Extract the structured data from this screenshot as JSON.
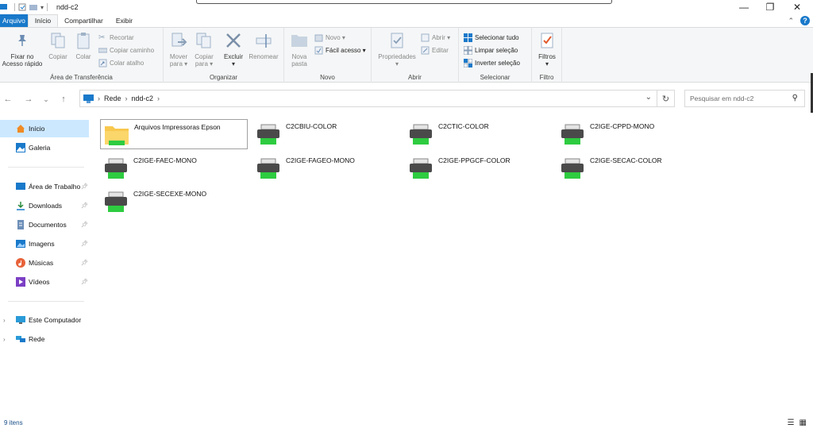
{
  "window": {
    "title": "ndd-c2",
    "minimize": "—",
    "maximize": "❐",
    "close": "✕"
  },
  "tabs": [
    {
      "label": "Arquivo"
    },
    {
      "label": "Início"
    },
    {
      "label": "Compartilhar"
    },
    {
      "label": "Exibir"
    }
  ],
  "ribbon": {
    "clipboard": {
      "label": "Área de Transferência",
      "pin_line1": "Fixar no",
      "pin_line2": "Acesso rápido",
      "copy": "Copiar",
      "paste": "Colar",
      "cut": "Recortar",
      "copy_path": "Copiar caminho",
      "paste_shortcut": "Colar atalho"
    },
    "organize": {
      "label": "Organizar",
      "move_line1": "Mover",
      "move_line2": "para ▾",
      "copy_line1": "Copiar",
      "copy_line2": "para ▾",
      "delete_line1": "Excluir",
      "delete_line2": "▾",
      "rename": "Renomear"
    },
    "new": {
      "label": "Novo",
      "new_folder_line1": "Nova",
      "new_folder_line2": "pasta",
      "new_item": "Novo ▾",
      "easy_access": "Fácil acesso ▾"
    },
    "open": {
      "label": "Abrir",
      "properties_line1": "Propriedades",
      "properties_line2": "▾",
      "open": "Abrir ▾",
      "edit": "Editar"
    },
    "select": {
      "label": "Selecionar",
      "select_all": "Selecionar tudo",
      "clear": "Limpar seleção",
      "invert": "Inverter seleção"
    },
    "filter": {
      "label": "Filtro",
      "filters_line1": "Filtros",
      "filters_line2": "▾"
    }
  },
  "nav": {
    "back": "←",
    "forward": "→",
    "recent": "⌄",
    "up": "↑",
    "breadcrumb": [
      "Rede",
      "ndd-c2"
    ],
    "refresh": "↻",
    "search_placeholder": "Pesquisar em ndd-c2"
  },
  "sidebar": {
    "items": [
      {
        "label": "Início",
        "icon": "home-icon"
      },
      {
        "label": "Galeria",
        "icon": "gallery-icon"
      },
      {
        "label": "Área de Trabalho",
        "icon": "desktop-icon"
      },
      {
        "label": "Downloads",
        "icon": "download-icon"
      },
      {
        "label": "Documentos",
        "icon": "documents-icon"
      },
      {
        "label": "Imagens",
        "icon": "pictures-icon"
      },
      {
        "label": "Músicas",
        "icon": "music-icon"
      },
      {
        "label": "Vídeos",
        "icon": "videos-icon"
      },
      {
        "label": "Este Computador",
        "icon": "computer-icon"
      },
      {
        "label": "Rede",
        "icon": "network-icon"
      }
    ]
  },
  "files": [
    {
      "name": "Arquivos Impressoras Epson",
      "type": "folder"
    },
    {
      "name": "C2CBIU-COLOR",
      "type": "printer"
    },
    {
      "name": "C2CTIC-COLOR",
      "type": "printer"
    },
    {
      "name": "C2IGE-CPPD-MONO",
      "type": "printer"
    },
    {
      "name": "C2IGE-FAEC-MONO",
      "type": "printer"
    },
    {
      "name": "C2IGE-FAGEO-MONO",
      "type": "printer"
    },
    {
      "name": "C2IGE-PPGCF-COLOR",
      "type": "printer"
    },
    {
      "name": "C2IGE-SECAC-COLOR",
      "type": "printer"
    },
    {
      "name": "C2IGE-SECEXE-MONO",
      "type": "printer"
    }
  ],
  "status": {
    "count": "9 itens"
  },
  "colors": {
    "accent": "#1979ca",
    "selection": "#cce8ff",
    "printer_green": "#2ecc40"
  }
}
